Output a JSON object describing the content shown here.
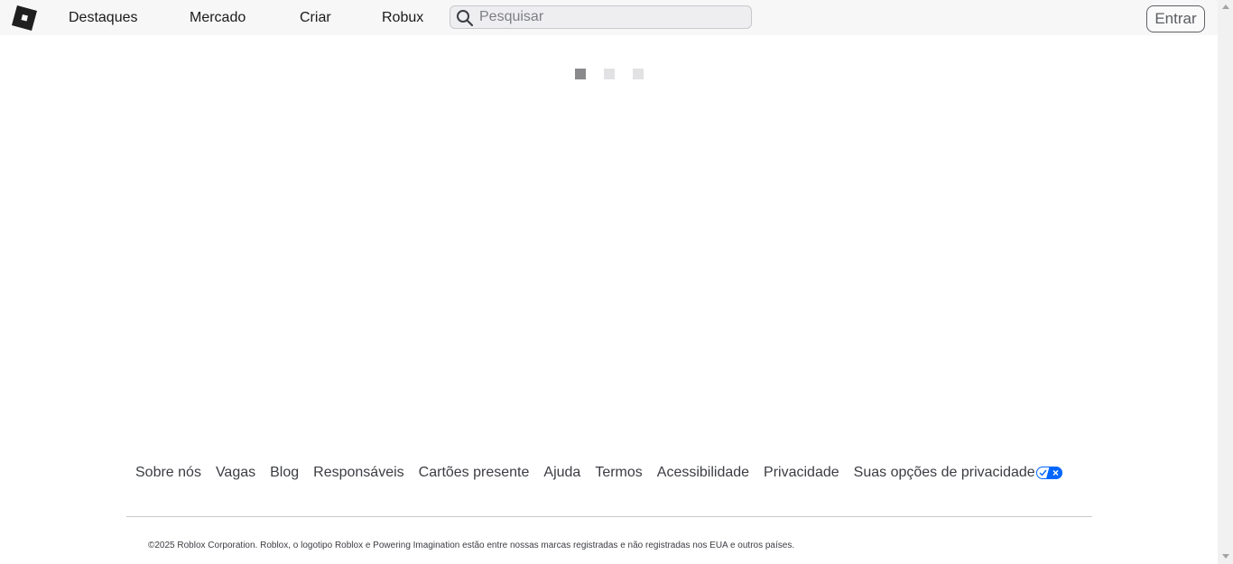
{
  "header": {
    "logo_icon": "roblox-logo-icon",
    "nav": [
      {
        "label": "Destaques"
      },
      {
        "label": "Mercado"
      },
      {
        "label": "Criar"
      },
      {
        "label": "Robux"
      }
    ],
    "search": {
      "placeholder": "Pesquisar",
      "value": "",
      "icon": "search-icon"
    },
    "login_label": "Entrar"
  },
  "main": {
    "loading": {
      "dots": 3,
      "active_index": 0
    }
  },
  "footer": {
    "links": [
      {
        "label": "Sobre nós"
      },
      {
        "label": "Vagas"
      },
      {
        "label": "Blog"
      },
      {
        "label": "Responsáveis"
      },
      {
        "label": "Cartões presente"
      },
      {
        "label": "Ajuda"
      },
      {
        "label": "Termos"
      },
      {
        "label": "Acessibilidade"
      },
      {
        "label": "Privacidade"
      },
      {
        "label": "Suas opções de privacidade"
      }
    ],
    "privacy_icon": "privacy-options-toggle-icon",
    "copyright": "©2025 Roblox Corporation. Roblox, o logotipo Roblox e Powering Imagination estão entre nossas marcas registradas e não registradas nos EUA e outros países."
  },
  "colors": {
    "header_bg": "#f7f7f8",
    "accent_blue": "#0066ff",
    "loader_active": "#8a8a8d",
    "loader_idle": "#e2e2e4"
  }
}
